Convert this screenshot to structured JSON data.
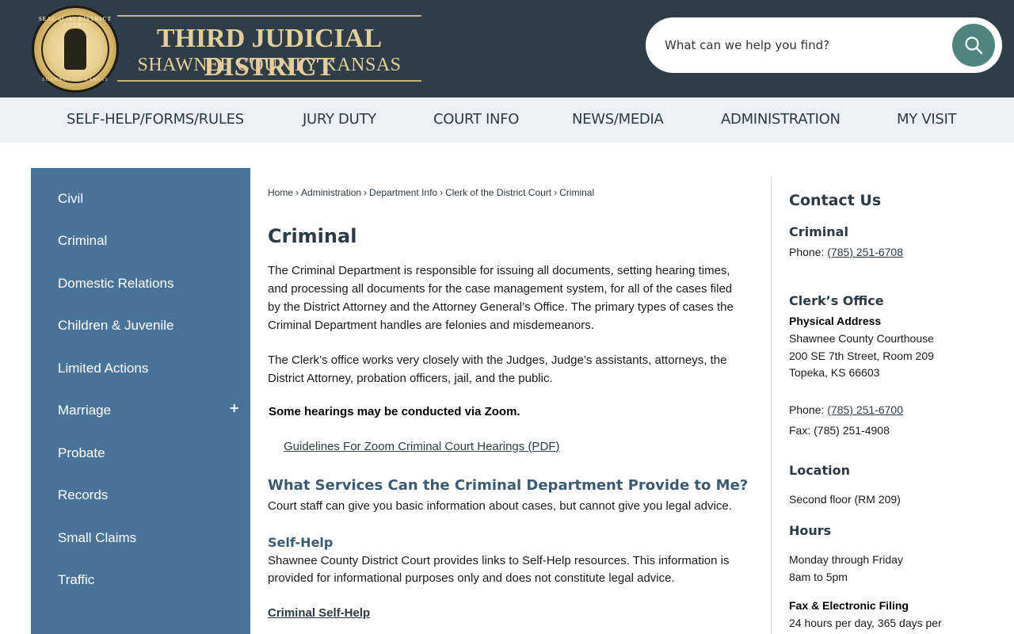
{
  "header": {
    "seal_text_top": "SEAL of the DISTRICT COURT",
    "seal_text_bottom": "SHAWNEE CO. KANSAS",
    "title_main": "THIRD JUDICIAL DISTRICT",
    "title_sub": "SHAWNEE COUNTY KANSAS",
    "search_placeholder": "What can we help you find?",
    "search_icon": "search-icon"
  },
  "nav": {
    "items": [
      "SELF-HELP/FORMS/RULES",
      "JURY DUTY",
      "COURT INFO",
      "NEWS/MEDIA",
      "ADMINISTRATION",
      "MY VISIT"
    ]
  },
  "sidebar": {
    "items": [
      "Civil",
      "Criminal",
      "Domestic Relations",
      "Children & Juvenile",
      "Limited Actions",
      "Marriage",
      "Probate",
      "Records",
      "Small Claims",
      "Traffic"
    ],
    "expand_symbol": "+"
  },
  "breadcrumb": [
    "Home",
    "Administration",
    "Department Info",
    "Clerk of the District Court",
    "Criminal"
  ],
  "main": {
    "title": "Criminal",
    "para1": "The Criminal Department is responsible for issuing all documents, setting hearing times, and processing all documents for the case management system, for all of the cases filed by the District Attorney and the Attorney General’s Office. The primary types of cases the Criminal Department handles are felonies and misdemeanors.",
    "para2": "The Clerk’s office works very closely with the Judges, Judge’s assistants, attorneys, the District Attorney, probation officers, jail, and the public.",
    "note": "Some hearings may be conducted via Zoom.",
    "pdf_link": "Guidelines For Zoom Criminal Court Hearings (PDF)",
    "services_heading": "What Services Can the Criminal Department Provide to Me?",
    "services_text": "Court staff can give you basic information about cases, but cannot give you legal advice.",
    "selfhelp_heading": "Self-Help",
    "selfhelp_text": "Shawnee County District Court provides links to Self-Help resources.  This information is provided for informational purposes only and does not constitute legal advice.",
    "selfhelp_link": "Criminal Self-Help"
  },
  "contact": {
    "heading": "Contact Us",
    "dept_heading": "Criminal",
    "dept_phone_label": "Phone: ",
    "dept_phone": "(785) 251-6708",
    "clerk_heading": "Clerk’s Office",
    "address_label": "Physical Address",
    "address_line1": "Shawnee County Courthouse",
    "address_line2": "200 SE 7th Street, Room 209",
    "address_line3": "Topeka, KS 66603",
    "clerk_phone_label": "Phone: ",
    "clerk_phone": "(785) 251-6700",
    "fax": "Fax: (785) 251-4908",
    "location_heading": "Location",
    "location_text": "Second floor (RM 209)",
    "hours_heading": "Hours",
    "hours_line1": "Monday through Friday",
    "hours_line2": "8am to 5pm",
    "filing_heading": "Fax & Electronic Filing",
    "filing_text": "24 hours per day, 365 days per"
  }
}
